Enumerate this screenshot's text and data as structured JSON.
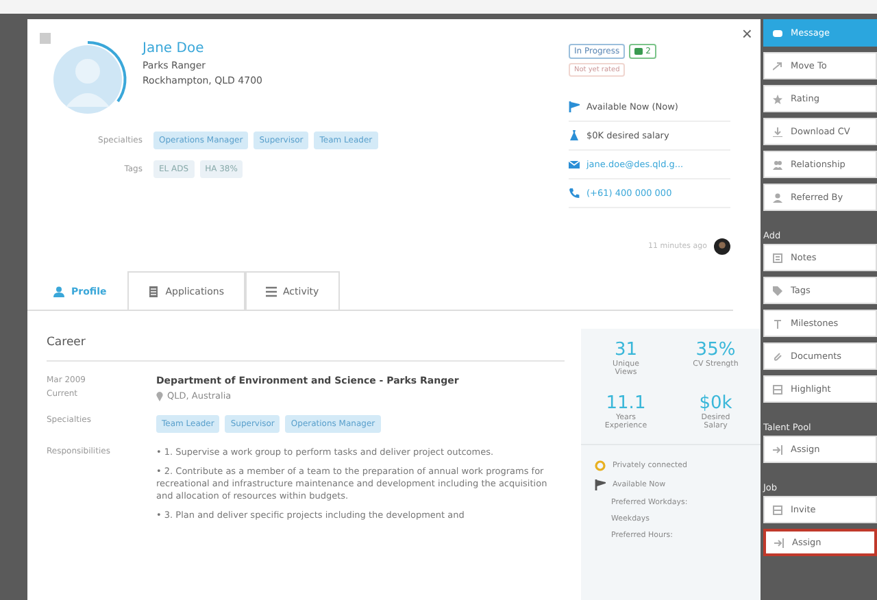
{
  "profile": {
    "name": "Jane Doe",
    "title": "Parks Ranger",
    "location": "Rockhampton, QLD 4700",
    "fields": [
      {
        "label": "Specialties",
        "tags": [
          "Operations Manager",
          "Supervisor",
          "Team Leader"
        ]
      },
      {
        "label": "Tags",
        "tags": [
          "EL ADS",
          "HA 38%"
        ]
      }
    ]
  },
  "status": {
    "label": "In Progress",
    "count": "2",
    "rating": "Not yet rated"
  },
  "contact": [
    {
      "kind": "flag",
      "text": "Available Now (Now)"
    },
    {
      "kind": "salary",
      "text": "$0K desired salary"
    },
    {
      "kind": "email",
      "text": "jane.doe@des.qld.g..."
    },
    {
      "kind": "phone",
      "text": "(+61) 400 000 000"
    }
  ],
  "updated": "11 minutes ago",
  "close": "×",
  "tabs": [
    {
      "kind": "person",
      "label": "Profile",
      "selected": true
    },
    {
      "kind": "doc",
      "label": "Applications",
      "selected": false
    },
    {
      "kind": "list",
      "label": "Activity",
      "selected": false
    }
  ],
  "career": {
    "heading": "Career",
    "dates": [
      "Mar 2009",
      "Current"
    ],
    "employer": "Department of Environment and Science - Parks Ranger",
    "place": "QLD, Australia",
    "specialties_label": "Specialties",
    "specialties": [
      "Team Leader",
      "Supervisor",
      "Operations Manager"
    ],
    "responsibilities_label": "Responsibilities",
    "responsibilities": [
      "• 1. Supervise a work group to perform tasks and deliver project outcomes.",
      "• 2. Contribute as a member of a team to the preparation of annual work programs for recreational and infrastructure maintenance and development including the acquisition and allocation of resources within budgets.",
      "• 3. Plan and deliver specific projects including the development and"
    ]
  },
  "stats": [
    {
      "value": "31",
      "label": "Unique Views"
    },
    {
      "value": "35%",
      "label": "CV Strength"
    },
    {
      "value": "11.1",
      "label": "Years Experience"
    },
    {
      "value": "$0k",
      "label": "Desired Salary"
    }
  ],
  "facts": [
    {
      "kind": "connect",
      "text": "Privately connected"
    },
    {
      "kind": "flag",
      "text": "Available Now"
    },
    {
      "kind": "plain",
      "text": "Preferred Workdays:"
    },
    {
      "kind": "plain",
      "text": "Weekdays"
    },
    {
      "kind": "plain",
      "text": "Preferred Hours:"
    }
  ],
  "actions": [
    {
      "buttons": [
        {
          "label": "Message",
          "selected": true,
          "outlined": false
        },
        {
          "label": "Move To",
          "selected": false,
          "outlined": false
        },
        {
          "label": "Rating",
          "selected": false,
          "outlined": false
        },
        {
          "label": "Download CV",
          "selected": false,
          "outlined": false
        },
        {
          "label": "Relationship",
          "selected": false,
          "outlined": false
        },
        {
          "label": "Referred By",
          "selected": false,
          "outlined": false
        }
      ]
    },
    {
      "heading": "Add",
      "buttons": [
        {
          "label": "Notes",
          "selected": false,
          "outlined": false
        },
        {
          "label": "Tags",
          "selected": false,
          "outlined": false
        },
        {
          "label": "Milestones",
          "selected": false,
          "outlined": false
        },
        {
          "label": "Documents",
          "selected": false,
          "outlined": false
        },
        {
          "label": "Highlight",
          "selected": false,
          "outlined": false
        }
      ]
    },
    {
      "heading": "Talent Pool",
      "buttons": [
        {
          "label": "Assign",
          "selected": false,
          "outlined": false
        }
      ]
    },
    {
      "heading": "Job",
      "buttons": [
        {
          "label": "Invite",
          "selected": false,
          "outlined": false
        },
        {
          "label": "Assign",
          "selected": false,
          "outlined": true
        }
      ]
    }
  ]
}
